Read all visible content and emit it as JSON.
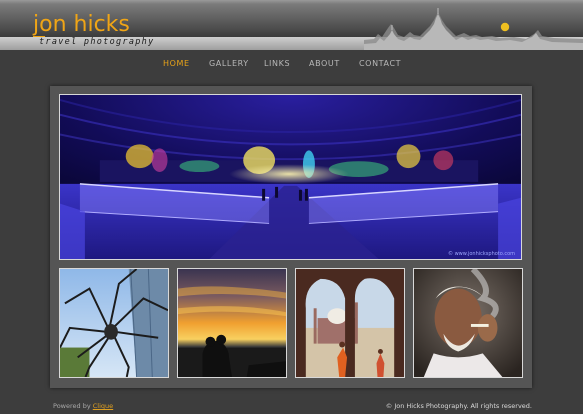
{
  "header": {
    "logo_name": "jon hicks",
    "logo_tagline": "travel photography",
    "brand_color": "#f0a516",
    "sun_color": "#f0c020"
  },
  "nav": {
    "items": [
      {
        "label": "HOME",
        "active": true
      },
      {
        "label": "GALLERY",
        "active": false
      },
      {
        "label": "LINKS",
        "active": false
      },
      {
        "label": "ABOUT",
        "active": false
      },
      {
        "label": "CONTACT",
        "active": false
      }
    ]
  },
  "hero": {
    "watermark": "© www.jonhicksphoto.com"
  },
  "thumbnails": [
    {
      "subject": "giant spider sculpture"
    },
    {
      "subject": "sunset silhouette couple"
    },
    {
      "subject": "mosque through arches"
    },
    {
      "subject": "old man smoking"
    }
  ],
  "footer": {
    "powered_prefix": "Powered by",
    "powered_link": "Clique",
    "copyright": "© Jon Hicks Photography. All rights reserved."
  }
}
